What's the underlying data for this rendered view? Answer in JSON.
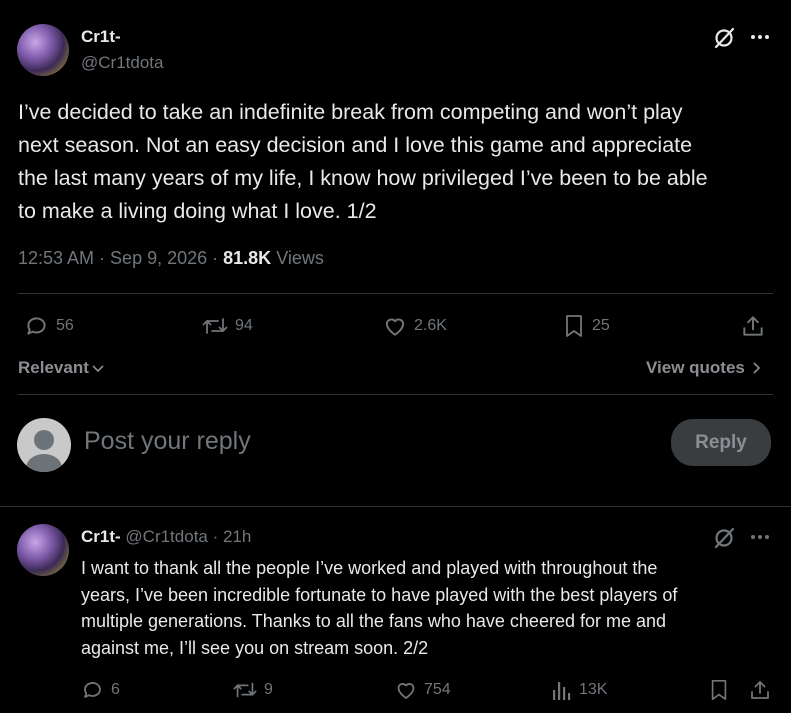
{
  "main_tweet": {
    "display_name": "Cr1t-",
    "handle": "@Cr1tdota",
    "text_lines": [
      "I’ve decided to take an indefinite break from competing and won’t play",
      "next season. Not an easy decision and I love this game and appreciate",
      "the last many years of my life, I know how privileged I’ve been to be able",
      "to make a living doing what I love. 1/2"
    ],
    "timestamp": "12:53 AM · Sep 9, 2026 · ",
    "views_count": "81.8K",
    "views_label": " Views",
    "replies": "56",
    "retweets": "94",
    "likes": "2.6K",
    "bookmarks": "25"
  },
  "filter": {
    "sort_label": "Relevant",
    "view_quotes_label": "View quotes"
  },
  "compose": {
    "placeholder": "Post your reply",
    "reply_button": "Reply"
  },
  "reply_tweet": {
    "display_name": "Cr1t-",
    "handle_time": "@Cr1tdota · 21h",
    "text_lines": [
      "I want to thank all the people I’ve worked and played with throughout the",
      "years, I’ve been incredible fortunate to have played with the best players of",
      "multiple generations. Thanks to all the fans who have cheered for me and",
      "against me, I’ll see you on stream soon. 2/2"
    ],
    "replies": "6",
    "retweets": "9",
    "likes": "754",
    "views": "13K"
  },
  "icons": {
    "grok": "grok-icon",
    "more": "more-icon",
    "reply": "reply-icon",
    "retweet": "retweet-icon",
    "like": "like-icon",
    "bookmark": "bookmark-icon",
    "share": "share-icon",
    "views": "views-icon"
  }
}
